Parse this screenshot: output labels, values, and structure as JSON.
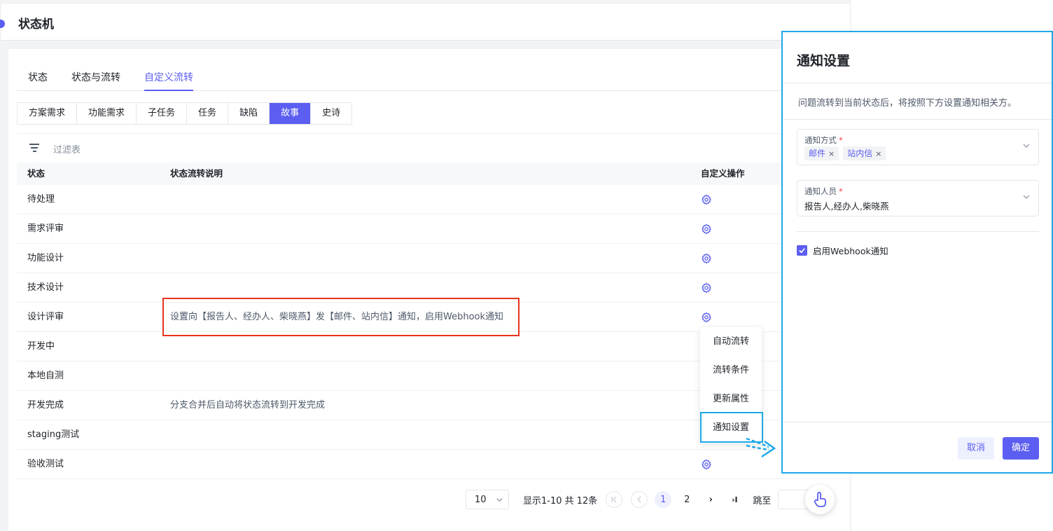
{
  "header": {
    "title": "状态机"
  },
  "tabs": [
    {
      "label": "状态",
      "active": false
    },
    {
      "label": "状态与流转",
      "active": false
    },
    {
      "label": "自定义流转",
      "active": true
    }
  ],
  "segments": [
    "方案需求",
    "功能需求",
    "子任务",
    "任务",
    "缺陷",
    "故事",
    "史诗"
  ],
  "segment_active": "故事",
  "filter": {
    "label": "过滤表"
  },
  "table": {
    "columns": [
      "状态",
      "状态流转说明",
      "自定义操作"
    ],
    "rows": [
      {
        "status": "待处理",
        "desc": ""
      },
      {
        "status": "需求评审",
        "desc": ""
      },
      {
        "status": "功能设计",
        "desc": ""
      },
      {
        "status": "技术设计",
        "desc": ""
      },
      {
        "status": "设计评审",
        "desc": "设置向【报告人、经办人、柴晓燕】发【邮件、站内信】通知，启用Webhook通知"
      },
      {
        "status": "开发中",
        "desc": ""
      },
      {
        "status": "本地自测",
        "desc": ""
      },
      {
        "status": "开发完成",
        "desc": "分支合并后自动将状态流转到开发完成"
      },
      {
        "status": "staging测试",
        "desc": ""
      },
      {
        "status": "验收测试",
        "desc": ""
      }
    ]
  },
  "menu": [
    "自动流转",
    "流转条件",
    "更新属性",
    "通知设置"
  ],
  "pager": {
    "page_size": "10",
    "info": "显示1-10 共 12条",
    "pages": [
      "1",
      "2"
    ],
    "current": "1",
    "next": "›",
    "last": "›I",
    "jump_label": "跳至"
  },
  "drawer": {
    "title": "通知设置",
    "hint": "问题流转到当前状态后，将按照下方设置通知相关方。",
    "method_label": "通知方式",
    "method_tags": [
      "邮件",
      "站内信"
    ],
    "people_label": "通知人员",
    "people_value": "报告人,经办人,柴晓燕",
    "required_mark": "*",
    "tag_remove": "×",
    "webhook_label": "启用Webhook通知",
    "webhook_checked": true,
    "cancel": "取消",
    "confirm": "确定"
  },
  "colors": {
    "primary": "#5b5ef0",
    "highlight_red": "#e8341c",
    "highlight_blue": "#1ea7e8"
  }
}
